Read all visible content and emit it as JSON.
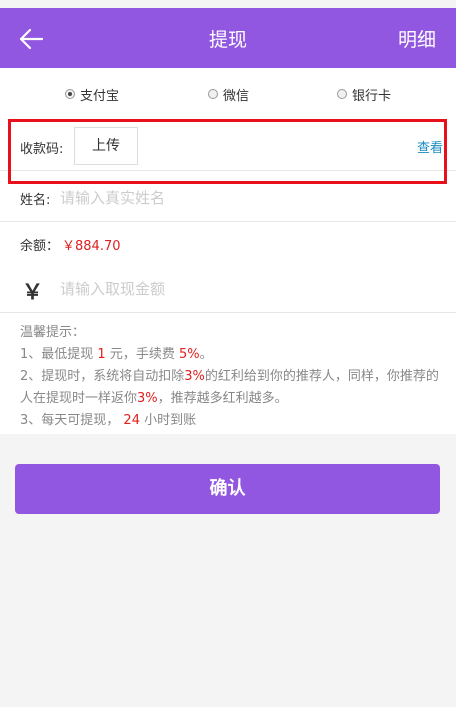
{
  "header": {
    "back_icon": "arrow-left-icon",
    "title": "提现",
    "detail_label": "明细",
    "background": "#9257e0"
  },
  "payment_methods": [
    {
      "label": "支付宝",
      "selected": true
    },
    {
      "label": "微信",
      "selected": false
    },
    {
      "label": "银行卡",
      "selected": false
    }
  ],
  "receipt_code": {
    "label": "收款码:",
    "upload_label": "上传",
    "view_label": "查看"
  },
  "name": {
    "label": "姓名:",
    "placeholder": "请输入真实姓名"
  },
  "balance": {
    "label": "余额：",
    "value": "￥884.70"
  },
  "amount": {
    "currency_symbol": "￥",
    "placeholder": "请输入取现金额"
  },
  "tips": {
    "title": "温馨提示：",
    "line1_a": "1、最低提现",
    "line1_min": "1",
    "line1_b": "元，手续费",
    "line1_fee": "5%",
    "line1_c": "。",
    "line2_a": "2、提现时，系统将自动扣除",
    "line2_pct1": "3%",
    "line2_b": "的红利给到你的推荐人，同样，你推荐的人在提现时一样返你",
    "line2_pct2": "3%",
    "line2_c": "，推荐越多红利越多。",
    "line3_a": "3、每天可提现，",
    "line3_hours": "24",
    "line3_b": "小时到账"
  },
  "confirm_label": "确认",
  "colors": {
    "accent": "#9257e0",
    "highlight_border": "#e8101a",
    "money_red": "#e02020",
    "link_blue": "#1a8cbf"
  }
}
